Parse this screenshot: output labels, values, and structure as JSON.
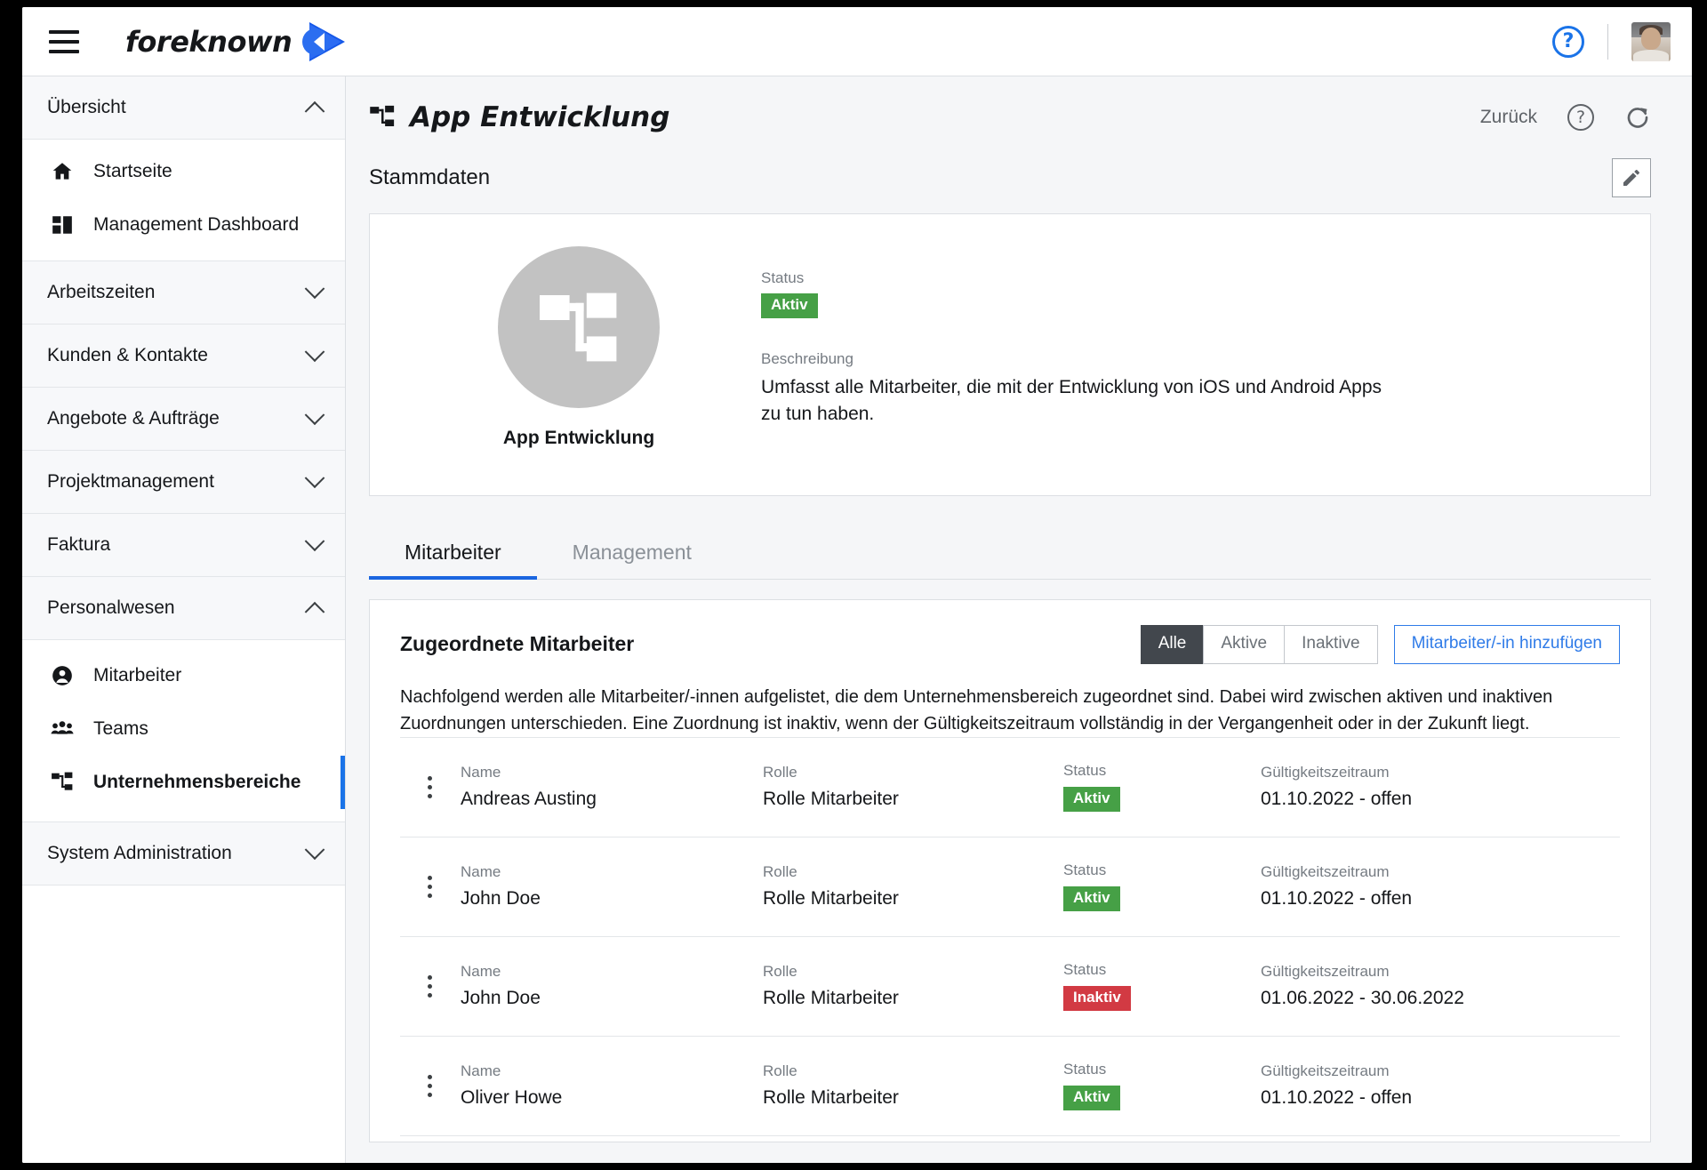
{
  "topbar": {
    "menu_icon": "hamburger-icon",
    "brand": "foreknown",
    "help_icon": "help-circle-icon",
    "avatar": "user-avatar"
  },
  "sidebar": {
    "groups": [
      {
        "label": "Übersicht",
        "expanded": true,
        "chevron": "chevron-up-icon",
        "items": [
          {
            "label": "Startseite",
            "icon": "home-icon"
          },
          {
            "label": "Management Dashboard",
            "icon": "dashboard-icon"
          }
        ]
      },
      {
        "label": "Arbeitszeiten",
        "expanded": false,
        "chevron": "chevron-down-icon",
        "items": []
      },
      {
        "label": "Kunden & Kontakte",
        "expanded": false,
        "chevron": "chevron-down-icon",
        "items": []
      },
      {
        "label": "Angebote & Aufträge",
        "expanded": false,
        "chevron": "chevron-down-icon",
        "items": []
      },
      {
        "label": "Projektmanagement",
        "expanded": false,
        "chevron": "chevron-down-icon",
        "items": []
      },
      {
        "label": "Faktura",
        "expanded": false,
        "chevron": "chevron-down-icon",
        "items": []
      },
      {
        "label": "Personalwesen",
        "expanded": true,
        "chevron": "chevron-up-icon",
        "items": [
          {
            "label": "Mitarbeiter",
            "icon": "person-icon"
          },
          {
            "label": "Teams",
            "icon": "people-icon"
          },
          {
            "label": "Unternehmensbereiche",
            "icon": "org-chart-icon",
            "active": true
          }
        ]
      },
      {
        "label": "System Administration",
        "expanded": false,
        "chevron": "chevron-down-icon",
        "items": []
      }
    ]
  },
  "page": {
    "title": "App Entwicklung",
    "title_icon": "org-chart-icon",
    "back_label": "Zurück",
    "help_icon": "help-circle-icon",
    "refresh_icon": "refresh-icon",
    "section_title": "Stammdaten",
    "edit_icon": "pencil-icon"
  },
  "master": {
    "avatar_icon": "org-chart-icon",
    "avatar_label": "App Entwicklung",
    "status_label": "Status",
    "status_value": "Aktiv",
    "description_label": "Beschreibung",
    "description_value": "Umfasst alle Mitarbeiter, die mit der Entwicklung von iOS und Android Apps zu tun haben."
  },
  "tabs": [
    {
      "label": "Mitarbeiter",
      "active": true
    },
    {
      "label": "Management",
      "active": false
    }
  ],
  "list": {
    "title": "Zugeordnete Mitarbeiter",
    "filters": [
      {
        "label": "Alle",
        "active": true
      },
      {
        "label": "Aktive",
        "active": false
      },
      {
        "label": "Inaktive",
        "active": false
      }
    ],
    "add_button": "Mitarbeiter/-in hinzufügen",
    "description": "Nachfolgend werden alle Mitarbeiter/-innen aufgelistet, die dem Unternehmensbereich zugeordnet sind. Dabei wird zwischen aktiven und inaktiven Zuordnungen unterschieden. Eine Zuordnung ist inaktiv, wenn der Gültigkeitszeitraum vollständig in der Vergangenheit oder in der Zukunft liegt.",
    "columns": {
      "name": "Name",
      "role": "Rolle",
      "status": "Status",
      "period": "Gültigkeitszeitraum"
    },
    "rows": [
      {
        "name": "Andreas Austing",
        "role": "Rolle Mitarbeiter",
        "status": "Aktiv",
        "status_kind": "active",
        "period": "01.10.2022 - offen"
      },
      {
        "name": "John Doe",
        "role": "Rolle Mitarbeiter",
        "status": "Aktiv",
        "status_kind": "active",
        "period": "01.10.2022 - offen"
      },
      {
        "name": "John Doe",
        "role": "Rolle Mitarbeiter",
        "status": "Inaktiv",
        "status_kind": "inactive",
        "period": "01.06.2022 - 30.06.2022"
      },
      {
        "name": "Oliver Howe",
        "role": "Rolle Mitarbeiter",
        "status": "Aktiv",
        "status_kind": "active",
        "period": "01.10.2022 - offen"
      }
    ]
  },
  "colors": {
    "accent": "#1a73e8",
    "status_active": "#46a046",
    "status_inactive": "#d23a43",
    "segment_active_bg": "#42474d"
  }
}
